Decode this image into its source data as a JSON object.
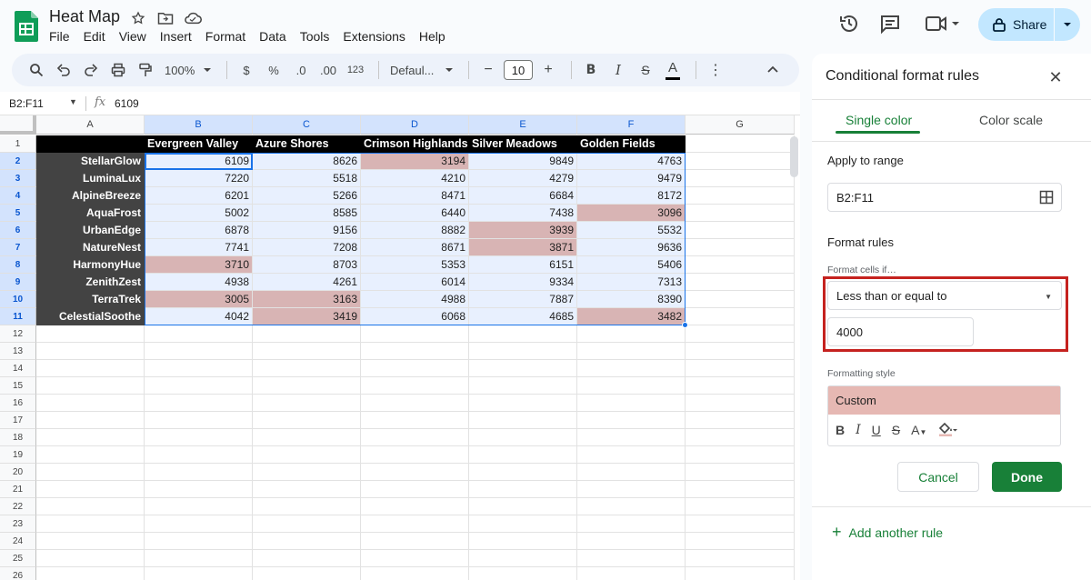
{
  "app": {
    "title": "Heat Map",
    "menu": [
      "File",
      "Edit",
      "View",
      "Insert",
      "Format",
      "Data",
      "Tools",
      "Extensions",
      "Help"
    ],
    "share_label": "Share"
  },
  "toolbar": {
    "zoom": "100%",
    "currency": "$",
    "percent": "%",
    "dec_decrease": ".0",
    "dec_increase": ".00",
    "number_format": "123",
    "font": "Defaul...",
    "font_size": "10",
    "minus": "−",
    "plus": "+",
    "bold": "B",
    "italic": "I",
    "strike": "S",
    "text_color": "A",
    "more": "⋮",
    "collapse": "⌃"
  },
  "formula_bar": {
    "name_box": "B2:F11",
    "fx": "fx",
    "value": "6109"
  },
  "sheet": {
    "columns": [
      "A",
      "B",
      "C",
      "D",
      "E",
      "F",
      "G"
    ],
    "row_numbers": [
      "1",
      "2",
      "3",
      "4",
      "5",
      "6",
      "7",
      "8",
      "9",
      "10",
      "11",
      "12",
      "13",
      "14",
      "15",
      "16",
      "17",
      "18",
      "19",
      "20",
      "21",
      "22",
      "23",
      "24",
      "25",
      "26"
    ],
    "headers": [
      "",
      "Evergreen Valley",
      "Azure Shores",
      "Crimson Highlands",
      "Silver Meadows",
      "Golden Fields"
    ],
    "rows": [
      {
        "name": "StellarGlow",
        "values": [
          "6109",
          "8626",
          "3194",
          "9849",
          "4763"
        ]
      },
      {
        "name": "LuminaLux",
        "values": [
          "7220",
          "5518",
          "4210",
          "4279",
          "9479"
        ]
      },
      {
        "name": "AlpineBreeze",
        "values": [
          "6201",
          "5266",
          "8471",
          "6684",
          "8172"
        ]
      },
      {
        "name": "AquaFrost",
        "values": [
          "5002",
          "8585",
          "6440",
          "7438",
          "3096"
        ]
      },
      {
        "name": "UrbanEdge",
        "values": [
          "6878",
          "9156",
          "8882",
          "3939",
          "5532"
        ]
      },
      {
        "name": "NatureNest",
        "values": [
          "7741",
          "7208",
          "8671",
          "3871",
          "9636"
        ]
      },
      {
        "name": "HarmonyHue",
        "values": [
          "3710",
          "8703",
          "5353",
          "6151",
          "5406"
        ]
      },
      {
        "name": "ZenithZest",
        "values": [
          "4938",
          "4261",
          "6014",
          "9334",
          "7313"
        ]
      },
      {
        "name": "TerraTrek",
        "values": [
          "3005",
          "3163",
          "4988",
          "7887",
          "8390"
        ]
      },
      {
        "name": "CelestialSoothe",
        "values": [
          "4042",
          "3419",
          "6068",
          "4685",
          "3482"
        ]
      }
    ],
    "highlight_threshold": 4000,
    "highlight_color": "#d8b4b4"
  },
  "panel": {
    "title": "Conditional format rules",
    "tab_single": "Single color",
    "tab_scale": "Color scale",
    "apply_label": "Apply to range",
    "range_value": "B2:F11",
    "rules_label": "Format rules",
    "cells_if_label": "Format cells if…",
    "condition": "Less than or equal to",
    "value": "4000",
    "style_label": "Formatting style",
    "style_preview": "Custom",
    "style_tools": [
      "B",
      "I",
      "U",
      "S",
      "A"
    ],
    "cancel_label": "Cancel",
    "done_label": "Done",
    "add_rule_label": "Add another rule"
  },
  "colors": {
    "accent": "#188038",
    "highlight_box": "#c5221f",
    "selection": "#1a73e8"
  }
}
